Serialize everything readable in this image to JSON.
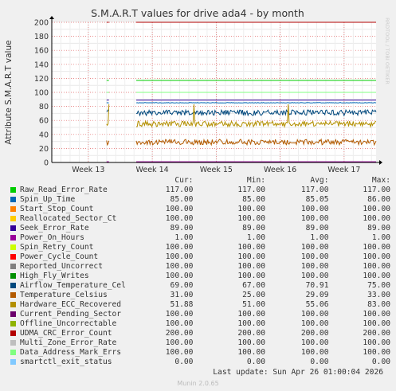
{
  "chart_data": {
    "type": "line",
    "title": "S.M.A.R.T values for drive ada4 - by month",
    "ylabel": "Attribute S.M.A.R.T value",
    "side_text": "RRDTOOL / TOBI OETIKER",
    "ylim": [
      0,
      200
    ],
    "yticks": [
      0,
      20,
      40,
      60,
      80,
      100,
      120,
      140,
      160,
      180,
      200
    ],
    "x_ticks": [
      "Week 13",
      "Week 14",
      "Week 15",
      "Week 16",
      "Week 17"
    ],
    "x_tick_positions": [
      0.16,
      0.44,
      0.72,
      1.0,
      1.28
    ],
    "x_range": [
      0,
      1.42
    ],
    "data_start": 0.24,
    "gap": [
      0.25,
      0.37
    ],
    "grid": true,
    "legend_headers": [
      "Cur:",
      "Min:",
      "Avg:",
      "Max:"
    ],
    "series": [
      {
        "name": "Raw_Read_Error_Rate",
        "color": "#00cc00",
        "cur": "117.00",
        "min": "117.00",
        "avg": "117.00",
        "max": "117.00"
      },
      {
        "name": "Spin_Up_Time",
        "color": "#0066b3",
        "cur": "85.00",
        "min": "85.00",
        "avg": "85.05",
        "max": "86.00"
      },
      {
        "name": "Start_Stop_Count",
        "color": "#ff8000",
        "cur": "100.00",
        "min": "100.00",
        "avg": "100.00",
        "max": "100.00"
      },
      {
        "name": "Reallocated_Sector_Ct",
        "color": "#ffcc00",
        "cur": "100.00",
        "min": "100.00",
        "avg": "100.00",
        "max": "100.00"
      },
      {
        "name": "Seek_Error_Rate",
        "color": "#330099",
        "cur": "89.00",
        "min": "89.00",
        "avg": "89.00",
        "max": "89.00"
      },
      {
        "name": "Power_On_Hours",
        "color": "#990099",
        "cur": "1.00",
        "min": "1.00",
        "avg": "1.00",
        "max": "1.00"
      },
      {
        "name": "Spin_Retry_Count",
        "color": "#ccff00",
        "cur": "100.00",
        "min": "100.00",
        "avg": "100.00",
        "max": "100.00"
      },
      {
        "name": "Power_Cycle_Count",
        "color": "#ff0000",
        "cur": "100.00",
        "min": "100.00",
        "avg": "100.00",
        "max": "100.00"
      },
      {
        "name": "Reported_Uncorrect",
        "color": "#808080",
        "cur": "100.00",
        "min": "100.00",
        "avg": "100.00",
        "max": "100.00"
      },
      {
        "name": "High_Fly_Writes",
        "color": "#008f00",
        "cur": "100.00",
        "min": "100.00",
        "avg": "100.00",
        "max": "100.00"
      },
      {
        "name": "Airflow_Temperature_Cel",
        "color": "#00487d",
        "cur": "69.00",
        "min": "67.00",
        "avg": "70.91",
        "max": "75.00"
      },
      {
        "name": "Temperature_Celsius",
        "color": "#b35a00",
        "cur": "31.00",
        "min": "25.00",
        "avg": "29.09",
        "max": "33.00"
      },
      {
        "name": "Hardware_ECC_Recovered",
        "color": "#b38f00",
        "cur": "51.88",
        "min": "51.00",
        "avg": "55.06",
        "max": "83.00"
      },
      {
        "name": "Current_Pending_Sector",
        "color": "#6b006b",
        "cur": "100.00",
        "min": "100.00",
        "avg": "100.00",
        "max": "100.00"
      },
      {
        "name": "Offline_Uncorrectable",
        "color": "#8fb300",
        "cur": "100.00",
        "min": "100.00",
        "avg": "100.00",
        "max": "100.00"
      },
      {
        "name": "UDMA_CRC_Error_Count",
        "color": "#b30000",
        "cur": "200.00",
        "min": "200.00",
        "avg": "200.00",
        "max": "200.00"
      },
      {
        "name": "Multi_Zone_Error_Rate",
        "color": "#bebebe",
        "cur": "100.00",
        "min": "100.00",
        "avg": "100.00",
        "max": "100.00"
      },
      {
        "name": "Data_Address_Mark_Errs",
        "color": "#80ff80",
        "cur": "100.00",
        "min": "100.00",
        "avg": "100.00",
        "max": "100.00"
      },
      {
        "name": "smartctl_exit_status",
        "color": "#80c9ff",
        "cur": "0.00",
        "min": "0.00",
        "avg": "0.00",
        "max": "0.00"
      }
    ]
  },
  "footer": {
    "last_update": "Last update: Sun Apr 26 01:00:04 2026",
    "version": "Munin 2.0.65"
  }
}
